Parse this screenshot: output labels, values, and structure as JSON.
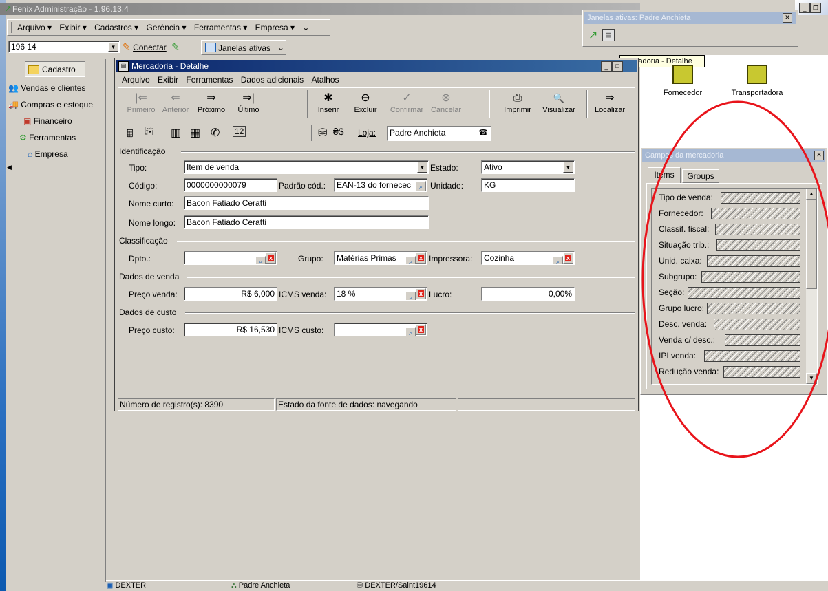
{
  "main_window": {
    "title": "Fenix Administração - 1.96.13.4",
    "menu": [
      "Arquivo ▾",
      "Exibir ▾",
      "Cadastros ▾",
      "Gerência ▾",
      "Ferramentas ▾",
      "Empresa ▾"
    ],
    "toolbar": {
      "connection_value": "196 14",
      "connect_label": "Conectar",
      "active_windows_label": "Janelas ativas"
    }
  },
  "sidebar": {
    "items": [
      "Cadastro",
      "Vendas e clientes",
      "Compras e estoque",
      "Financeiro",
      "Ferramentas",
      "Empresa"
    ]
  },
  "active_windows_panel": {
    "title": "Janelas ativas: Padre Anchieta",
    "tooltip": "Mercadoria - Detalhe"
  },
  "desktop_icons": [
    "Fornecedor",
    "Transportadora"
  ],
  "detail_window": {
    "title": "Mercadoria - Detalhe",
    "menu": [
      "Arquivo",
      "Exibir",
      "Ferramentas",
      "Dados adicionais",
      "Atalhos"
    ],
    "nav_buttons": [
      {
        "label": "Primeiro",
        "glyph": "|⇐",
        "enabled": false
      },
      {
        "label": "Anterior",
        "glyph": "⇐",
        "enabled": false
      },
      {
        "label": "Próximo",
        "glyph": "⇒",
        "enabled": true
      },
      {
        "label": "Último",
        "glyph": "⇒|",
        "enabled": true
      },
      {
        "label": "Inserir",
        "glyph": "✱",
        "enabled": true
      },
      {
        "label": "Excluir",
        "glyph": "⊖",
        "enabled": true
      },
      {
        "label": "Confirmar",
        "glyph": "✓",
        "enabled": false
      },
      {
        "label": "Cancelar",
        "glyph": "⊗",
        "enabled": false
      },
      {
        "label": "Imprimir",
        "glyph": "⎙",
        "enabled": true
      },
      {
        "label": "Visualizar",
        "glyph": "🔍",
        "enabled": true
      },
      {
        "label": "Localizar",
        "glyph": "⇒",
        "enabled": true
      }
    ],
    "loja_label": "Loja:",
    "loja_value": "Padre Anchieta",
    "sections": {
      "identificacao": "Identificação",
      "classificacao": "Classificação",
      "dados_venda": "Dados de venda",
      "dados_custo": "Dados de custo"
    },
    "fields": {
      "tipo_label": "Tipo:",
      "tipo_value": "Item de venda",
      "estado_label": "Estado:",
      "estado_value": "Ativo",
      "codigo_label": "Código:",
      "codigo_value": "0000000000079",
      "padrao_label": "Padrão cód.:",
      "padrao_value": "EAN-13 do fornecec",
      "unidade_label": "Unidade:",
      "unidade_value": "KG",
      "nome_curto_label": "Nome curto:",
      "nome_curto_value": "Bacon Fatiado Ceratti",
      "nome_longo_label": "Nome longo:",
      "nome_longo_value": "Bacon Fatiado Ceratti",
      "dpto_label": "Dpto.:",
      "dpto_value": "",
      "grupo_label": "Grupo:",
      "grupo_value": "Matérias Primas",
      "impressora_label": "Impressora:",
      "impressora_value": "Cozinha",
      "preco_venda_label": "Preço venda:",
      "preco_venda_value": "R$ 6,000",
      "icms_venda_label": "ICMS venda:",
      "icms_venda_value": "18 %",
      "lucro_label": "Lucro:",
      "lucro_value": "0,00%",
      "preco_custo_label": "Preço custo:",
      "preco_custo_value": "R$ 16,530",
      "icms_custo_label": "ICMS custo:",
      "icms_custo_value": ""
    },
    "status": {
      "registros": "Número de registro(s): 8390",
      "estado": "Estado da fonte de dados: navegando"
    }
  },
  "fields_panel": {
    "title": "Campos da mercadoria",
    "tabs": [
      "Items",
      "Groups"
    ],
    "items": [
      "Tipo de venda:",
      "Fornecedor:",
      "Classif. fiscal:",
      "Situação trib.:",
      "Unid. caixa:",
      "Subgrupo:",
      "Seção:",
      "Grupo lucro:",
      "Desc. venda:",
      "Venda c/ desc.:",
      "IPI venda:",
      "Redução venda:"
    ]
  },
  "taskbar": {
    "items": [
      "DEXTER",
      "Padre Anchieta",
      "DEXTER/Saint19614"
    ]
  },
  "colors": {
    "annotation_circle": "#e8141b",
    "titlebar_active": "#0a246a",
    "titlebar_inactive": "#a6b8d3"
  }
}
